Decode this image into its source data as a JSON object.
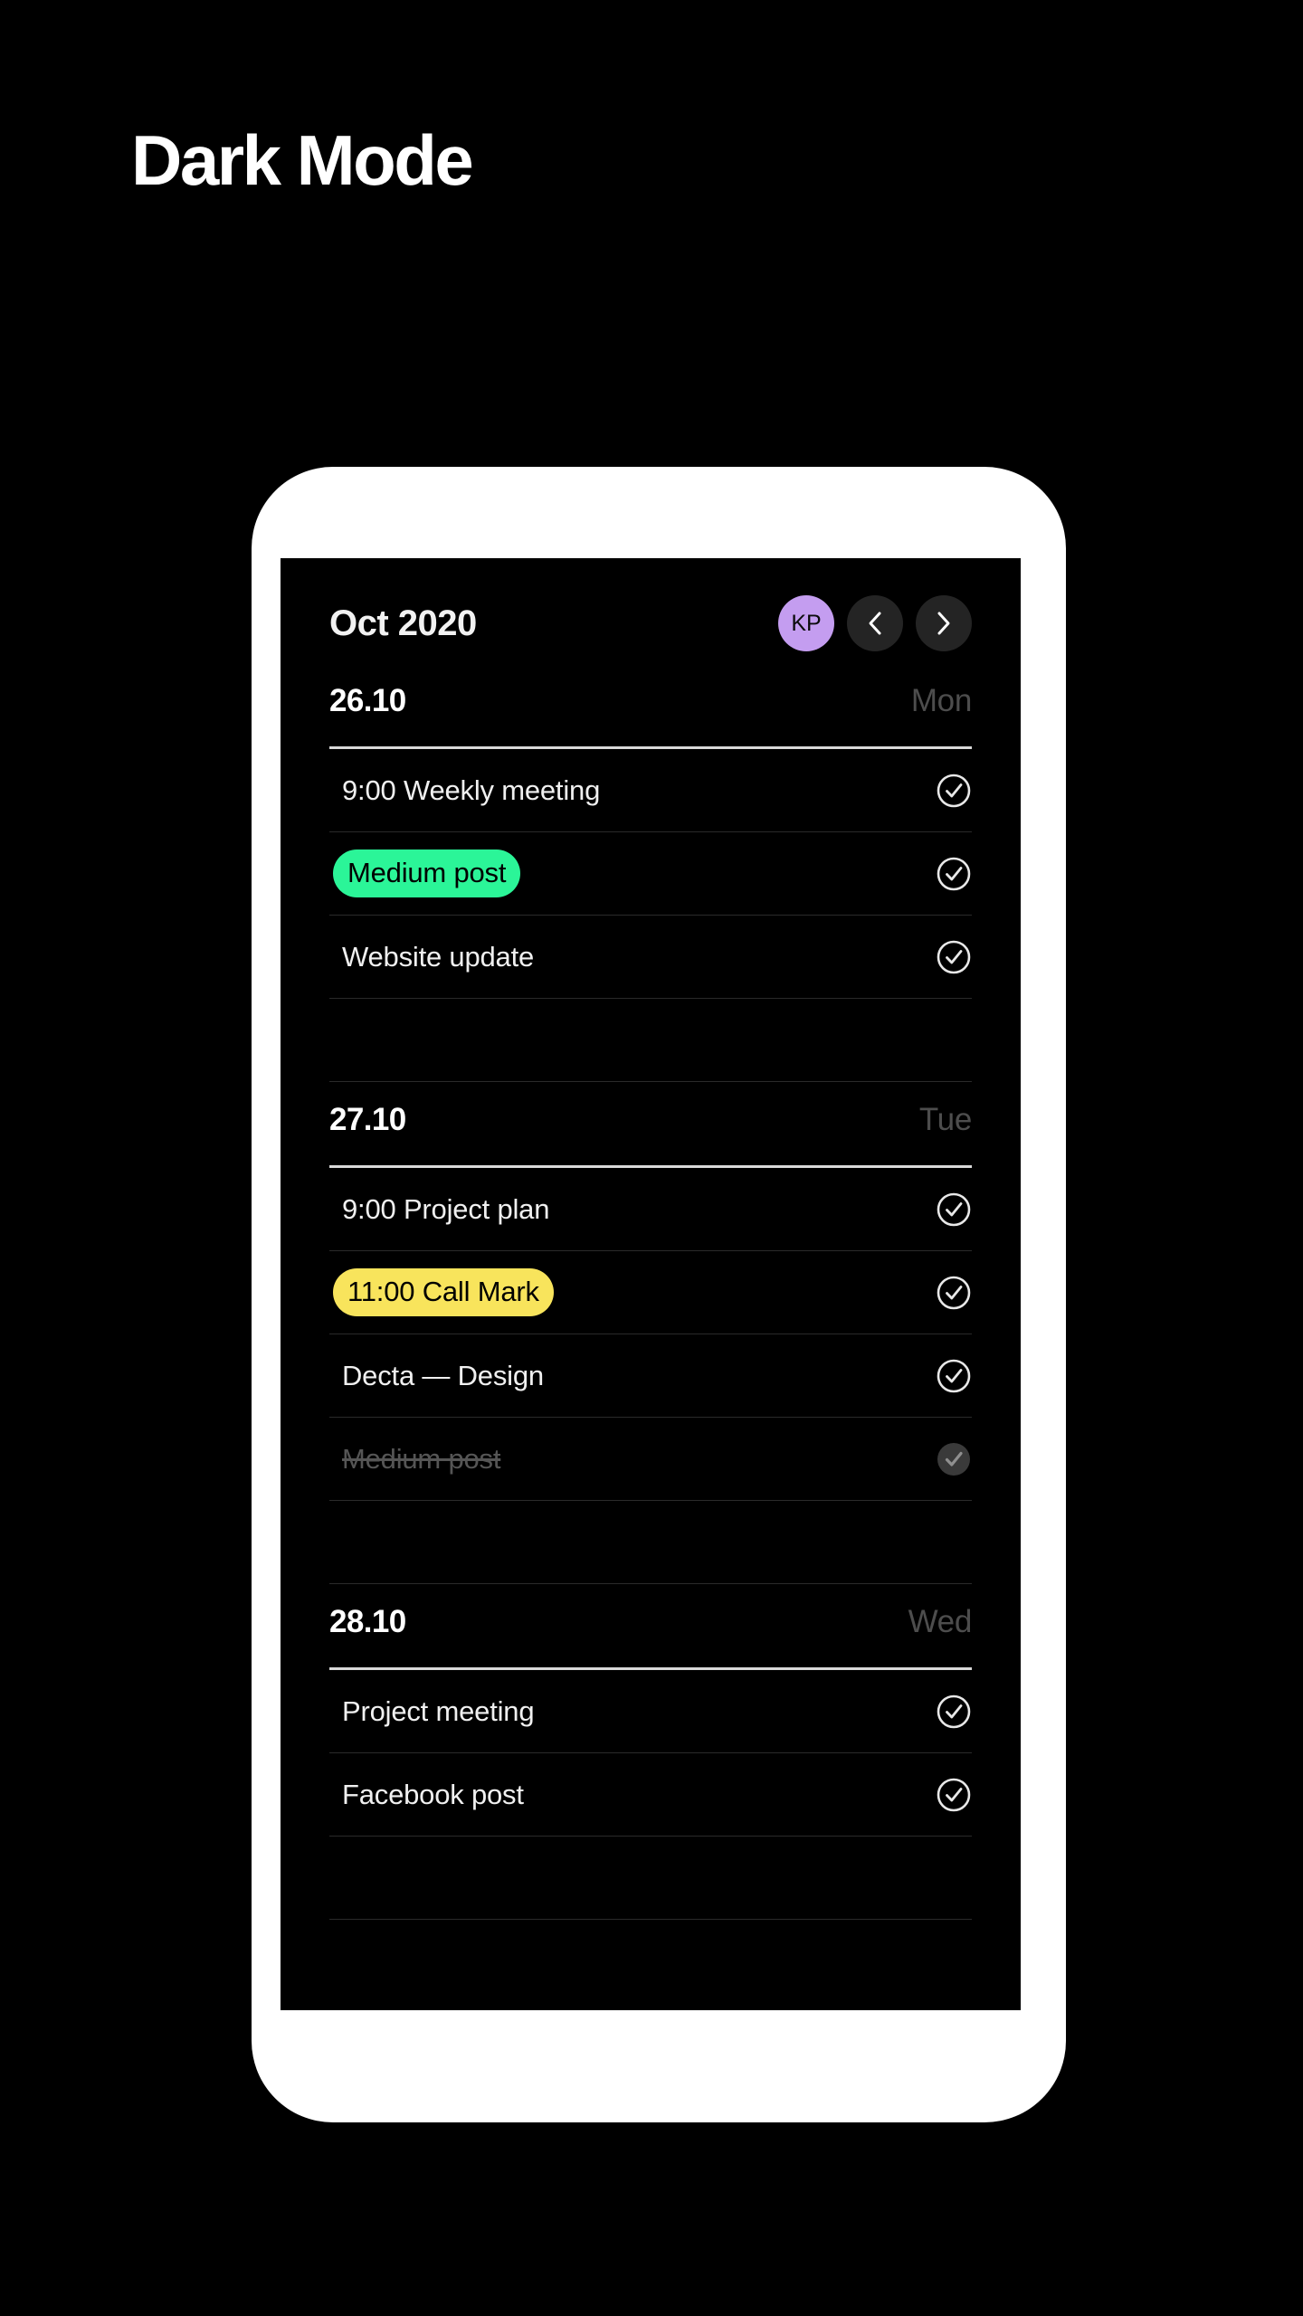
{
  "page": {
    "title": "Dark Mode",
    "background": "#000000"
  },
  "app": {
    "header": {
      "month": "Oct 2020",
      "avatar_initials": "KP",
      "avatar_color": "#c49df0",
      "prev_icon": "chevron-left-icon",
      "next_icon": "chevron-right-icon",
      "nav_button_color": "#242424"
    },
    "colors": {
      "accent_green": "#2bf598",
      "accent_yellow": "#f8e45c",
      "text_primary": "#f0f0f0",
      "text_muted": "#4d4d4d",
      "done_text": "#555555",
      "divider": "#2a2a2a",
      "day_rule": "#d9d9d9"
    },
    "days": [
      {
        "date": "26.10",
        "weekday": "Mon",
        "tasks": [
          {
            "label": "9:00 Weekly meeting",
            "highlight": "none",
            "done": false
          },
          {
            "label": "Medium post",
            "highlight": "green",
            "done": false
          },
          {
            "label": "Website update",
            "highlight": "none",
            "done": false
          },
          {
            "label": "",
            "highlight": "none",
            "done": false
          }
        ]
      },
      {
        "date": "27.10",
        "weekday": "Tue",
        "tasks": [
          {
            "label": "9:00 Project plan",
            "highlight": "none",
            "done": false
          },
          {
            "label": "11:00 Call Mark",
            "highlight": "yellow",
            "done": false
          },
          {
            "label": "Decta — Design",
            "highlight": "none",
            "done": false
          },
          {
            "label": "Medium post",
            "highlight": "none",
            "done": true
          },
          {
            "label": "",
            "highlight": "none",
            "done": false
          }
        ]
      },
      {
        "date": "28.10",
        "weekday": "Wed",
        "tasks": [
          {
            "label": "Project meeting",
            "highlight": "none",
            "done": false
          },
          {
            "label": "Facebook post",
            "highlight": "none",
            "done": false
          },
          {
            "label": "",
            "highlight": "none",
            "done": false
          }
        ]
      }
    ]
  }
}
